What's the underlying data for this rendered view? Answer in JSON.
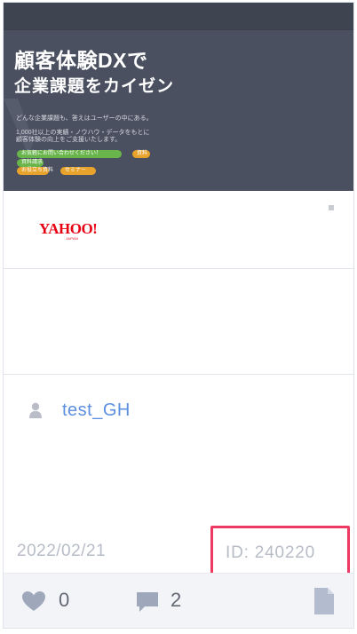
{
  "banner": {
    "title": "顧客体験DXで",
    "subtitle": "企業課題をカイゼン",
    "small_line_1": "どんな企業課題も、答えはユーザーの中にある。",
    "small_line_2": "1,000社以上の実績・ノウハウ・データをもとに",
    "small_line_3": "顧客体験の向上をご支援いたします。",
    "pill_1": "お気軽にお問い合わせください！",
    "pill_2": "資料",
    "pill_3": "資料請求",
    "pill_4": "お役立ち資料",
    "pill_5": "セミナー",
    "colors": {
      "background": "#4a5060",
      "green": "#69b54c",
      "orange": "#e7a32c"
    }
  },
  "logo": {
    "text": "YAHOO!",
    "sub": "JAPAN",
    "color": "#e60012"
  },
  "user": {
    "icon": "user-icon",
    "name": "test_GH"
  },
  "meta": {
    "date": "2022/02/21",
    "id_label": "ID: 240220",
    "highlight_color": "#ee3a62"
  },
  "actions": {
    "like_icon": "heart-icon",
    "like_count": "0",
    "comment_icon": "comment-icon",
    "comment_count": "2",
    "document_icon": "document-icon"
  }
}
